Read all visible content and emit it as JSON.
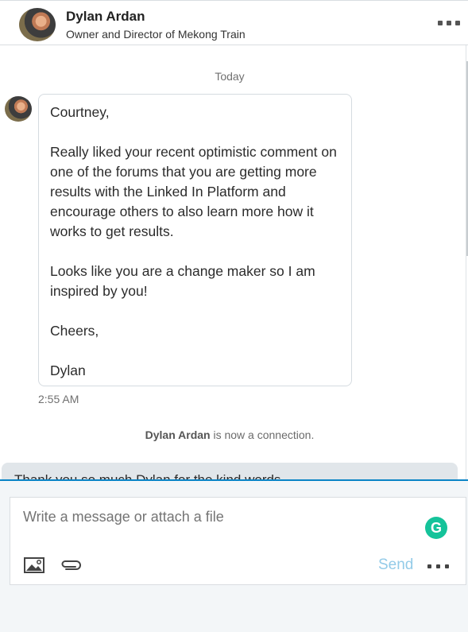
{
  "header": {
    "name": "Dylan Ardan",
    "headline": "Owner and Director of Mekong Train"
  },
  "thread": {
    "day_label": "Today",
    "message": {
      "paragraphs": [
        "Courtney,",
        "Really liked your recent optimistic comment on one of the forums that you are getting more results with the Linked In Platform and encourage others to also learn more how it works to get results.",
        "Looks like you are a change maker so I am inspired by you!",
        "Cheers,",
        "Dylan"
      ],
      "time": "2:55 AM"
    },
    "connection": {
      "name": "Dylan Ardan",
      "text": " is now a connection."
    },
    "partial_reply": "Thank you so much Dylan for the kind words..."
  },
  "composer": {
    "placeholder": "Write a message or attach a file",
    "send_label": "Send",
    "grammarly_letter": "G"
  },
  "icons": {
    "more": "more-horizontal-icon",
    "image": "image-icon",
    "attach": "paperclip-icon",
    "grammarly": "grammarly-icon"
  },
  "colors": {
    "accent": "#0a84c6",
    "send_disabled": "#93cbe8",
    "grammarly": "#15c39a"
  }
}
